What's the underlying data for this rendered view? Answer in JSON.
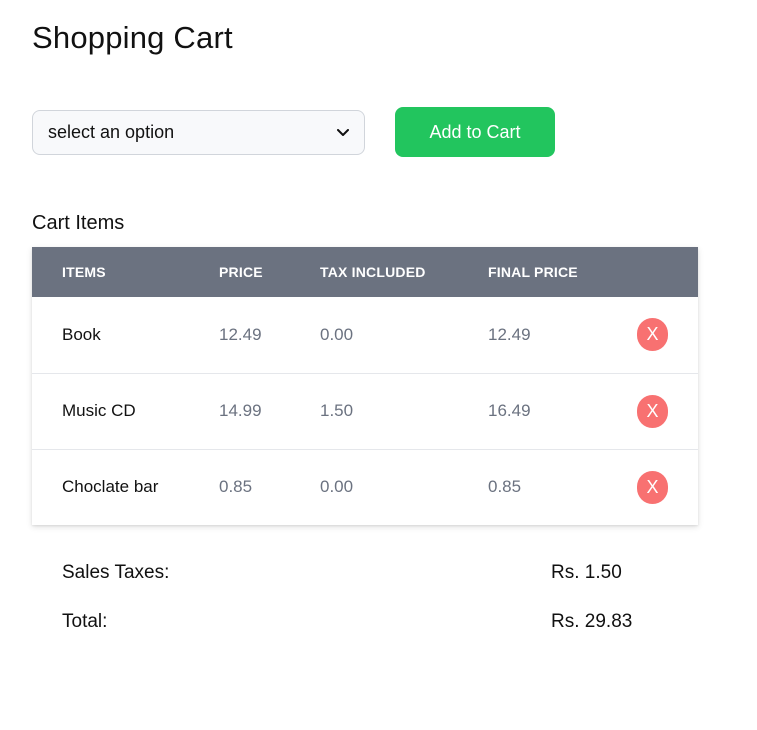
{
  "page": {
    "title": "Shopping Cart"
  },
  "controls": {
    "select": {
      "selected_label": "select an option"
    },
    "add_button_label": "Add to Cart"
  },
  "cart": {
    "heading": "Cart Items",
    "columns": [
      "ITEMS",
      "PRICE",
      "TAX INCLUDED",
      "FINAL PRICE"
    ],
    "rows": [
      {
        "item": "Book",
        "price": "12.49",
        "tax": "0.00",
        "final": "12.49",
        "remove_label": "X"
      },
      {
        "item": "Music CD",
        "price": "14.99",
        "tax": "1.50",
        "final": "16.49",
        "remove_label": "X"
      },
      {
        "item": "Choclate bar",
        "price": "0.85",
        "tax": "0.00",
        "final": "0.85",
        "remove_label": "X"
      }
    ]
  },
  "summary": {
    "sales_taxes_label": "Sales Taxes:",
    "sales_taxes_value": "Rs. 1.50",
    "total_label": "Total:",
    "total_value": "Rs. 29.83"
  },
  "colors": {
    "accent_green": "#22c55e",
    "header_gray": "#6b7280",
    "remove_red": "#f87171"
  },
  "icons": {
    "select_chevron": "chevron-down-icon"
  }
}
